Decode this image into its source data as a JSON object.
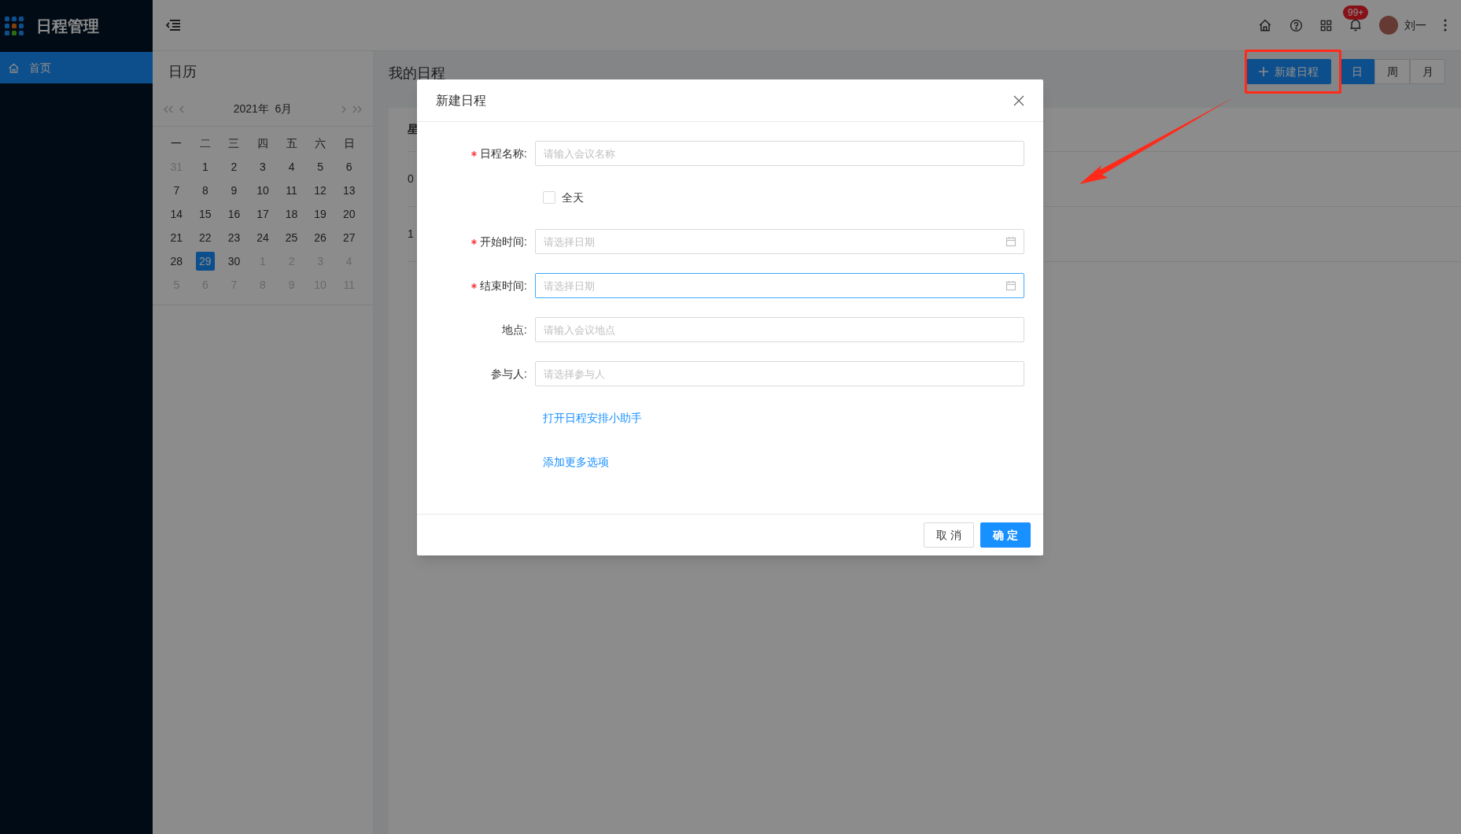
{
  "app": {
    "title": "日程管理"
  },
  "sidebar": {
    "items": [
      {
        "label": "首页",
        "selected": true
      }
    ]
  },
  "header": {
    "notification_badge": "99+",
    "user_name": "刘一"
  },
  "calendar": {
    "title": "日历",
    "month_label": "2021年  6月",
    "weekdays": [
      "一",
      "二",
      "三",
      "四",
      "五",
      "六",
      "日"
    ],
    "weeks": [
      [
        {
          "day": "31",
          "muted": true,
          "selected": false
        },
        {
          "day": "1",
          "muted": false,
          "selected": false
        },
        {
          "day": "2",
          "muted": false,
          "selected": false
        },
        {
          "day": "3",
          "muted": false,
          "selected": false
        },
        {
          "day": "4",
          "muted": false,
          "selected": false
        },
        {
          "day": "5",
          "muted": false,
          "selected": false
        },
        {
          "day": "6",
          "muted": false,
          "selected": false
        }
      ],
      [
        {
          "day": "7",
          "muted": false,
          "selected": false
        },
        {
          "day": "8",
          "muted": false,
          "selected": false
        },
        {
          "day": "9",
          "muted": false,
          "selected": false
        },
        {
          "day": "10",
          "muted": false,
          "selected": false
        },
        {
          "day": "11",
          "muted": false,
          "selected": false
        },
        {
          "day": "12",
          "muted": false,
          "selected": false
        },
        {
          "day": "13",
          "muted": false,
          "selected": false
        }
      ],
      [
        {
          "day": "14",
          "muted": false,
          "selected": false
        },
        {
          "day": "15",
          "muted": false,
          "selected": false
        },
        {
          "day": "16",
          "muted": false,
          "selected": false
        },
        {
          "day": "17",
          "muted": false,
          "selected": false
        },
        {
          "day": "18",
          "muted": false,
          "selected": false
        },
        {
          "day": "19",
          "muted": false,
          "selected": false
        },
        {
          "day": "20",
          "muted": false,
          "selected": false
        }
      ],
      [
        {
          "day": "21",
          "muted": false,
          "selected": false
        },
        {
          "day": "22",
          "muted": false,
          "selected": false
        },
        {
          "day": "23",
          "muted": false,
          "selected": false
        },
        {
          "day": "24",
          "muted": false,
          "selected": false
        },
        {
          "day": "25",
          "muted": false,
          "selected": false
        },
        {
          "day": "26",
          "muted": false,
          "selected": false
        },
        {
          "day": "27",
          "muted": false,
          "selected": false
        }
      ],
      [
        {
          "day": "28",
          "muted": false,
          "selected": false
        },
        {
          "day": "29",
          "muted": false,
          "selected": true
        },
        {
          "day": "30",
          "muted": false,
          "selected": false
        },
        {
          "day": "1",
          "muted": true,
          "selected": false
        },
        {
          "day": "2",
          "muted": true,
          "selected": false
        },
        {
          "day": "3",
          "muted": true,
          "selected": false
        },
        {
          "day": "4",
          "muted": true,
          "selected": false
        }
      ],
      [
        {
          "day": "5",
          "muted": true,
          "selected": false
        },
        {
          "day": "6",
          "muted": true,
          "selected": false
        },
        {
          "day": "7",
          "muted": true,
          "selected": false
        },
        {
          "day": "8",
          "muted": true,
          "selected": false
        },
        {
          "day": "9",
          "muted": true,
          "selected": false
        },
        {
          "day": "10",
          "muted": true,
          "selected": false
        },
        {
          "day": "11",
          "muted": true,
          "selected": false
        }
      ]
    ]
  },
  "main": {
    "title": "我的日程",
    "new_button": "新建日程",
    "views": [
      {
        "label": "日",
        "selected": true
      },
      {
        "label": "周",
        "selected": false
      },
      {
        "label": "月",
        "selected": false
      }
    ],
    "schedule": {
      "header": "星",
      "rows": [
        "0",
        "1"
      ]
    }
  },
  "dialog": {
    "title": "新建日程",
    "fields": [
      {
        "kind": "input",
        "label": "日程名称:",
        "required": true,
        "placeholder": "请输入会议名称",
        "focused": false
      },
      {
        "kind": "checkbox",
        "label": "全天",
        "checked": false
      },
      {
        "kind": "date",
        "label": "开始时间:",
        "required": true,
        "placeholder": "请选择日期",
        "focused": false
      },
      {
        "kind": "date",
        "label": "结束时间:",
        "required": true,
        "placeholder": "请选择日期",
        "focused": true
      },
      {
        "kind": "input",
        "label": "地点:",
        "required": false,
        "placeholder": "请输入会议地点",
        "focused": false
      },
      {
        "kind": "input",
        "label": "参与人:",
        "required": false,
        "placeholder": "请选择参与人",
        "focused": false
      }
    ],
    "links": [
      "打开日程安排小助手",
      "添加更多选项"
    ],
    "cancel": "取 消",
    "ok": "确 定"
  }
}
